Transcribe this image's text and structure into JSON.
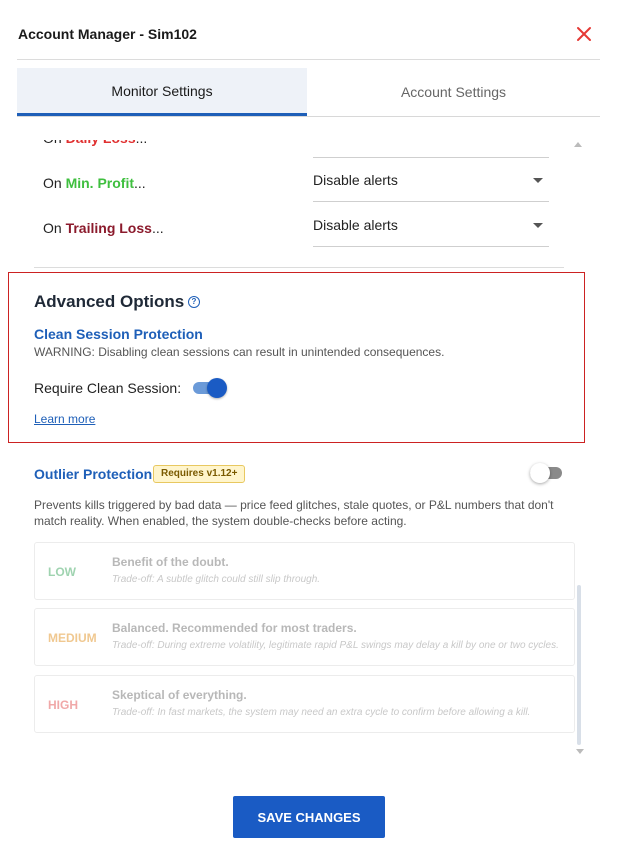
{
  "window": {
    "title": "Account Manager - Sim102",
    "close_icon": "close-icon",
    "close_color": "#e53935"
  },
  "tabs": [
    {
      "label": "Monitor Settings",
      "active": true
    },
    {
      "label": "Account Settings",
      "active": false
    }
  ],
  "monitor_rows": [
    {
      "prefix": "On ",
      "keyword": "Daily Loss",
      "suffix": "...",
      "keyword_color": "#e03030",
      "value": ""
    },
    {
      "prefix": "On ",
      "keyword": "Min. Profit",
      "suffix": "...",
      "keyword_color": "#3fbf3f",
      "value": "Disable alerts"
    },
    {
      "prefix": "On ",
      "keyword": "Trailing Loss",
      "suffix": "...",
      "keyword_color": "#8b1a2c",
      "value": "Disable alerts"
    }
  ],
  "advanced": {
    "title": "Advanced Options",
    "help_icon": "help-circle-icon",
    "clean_session": {
      "title": "Clean Session Protection",
      "warning": "WARNING: Disabling clean sessions can result in unintended consequences.",
      "toggle_label": "Require Clean Session:",
      "toggle_on": true,
      "learn_more": "Learn more"
    },
    "outlier": {
      "title": "Outlier Protection",
      "badge": "Requires v1.12+",
      "toggle_on": false,
      "description": "Prevents kills triggered by bad data — price feed glitches, stale quotes, or P&L numbers that don't match reality. When enabled, the system double-checks before acting.",
      "levels": [
        {
          "level": "LOW",
          "title": "Benefit of the doubt.",
          "tradeoff": "Trade-off: A subtle glitch could still slip through.",
          "color": "#9fd3b0"
        },
        {
          "level": "MEDIUM",
          "title": "Balanced. Recommended for most traders.",
          "tradeoff": "Trade-off: During extreme volatility, legitimate rapid P&L swings may delay a kill by one or two cycles.",
          "color": "#f0c890"
        },
        {
          "level": "HIGH",
          "title": "Skeptical of everything.",
          "tradeoff": "Trade-off: In fast markets, the system may need an extra cycle to confirm before allowing a kill.",
          "color": "#f0a8a8"
        }
      ]
    }
  },
  "footer": {
    "save_label": "SAVE CHANGES",
    "accent": "#1a5bc4"
  }
}
